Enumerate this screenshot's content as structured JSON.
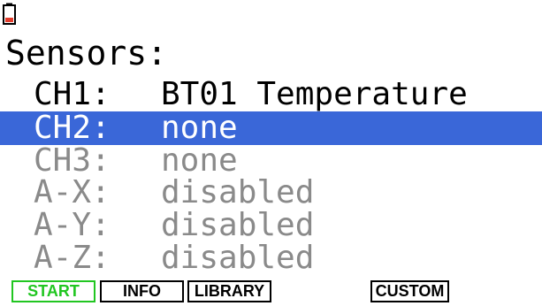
{
  "status": {
    "battery_icon": "battery-low-icon",
    "battery_color": "#e23a2a"
  },
  "screen": {
    "heading": "Sensors:"
  },
  "channels": [
    {
      "label": "CH1:",
      "value": "BT01 Temperature"
    },
    {
      "label": "CH2:",
      "value": "none"
    },
    {
      "label": "CH3:",
      "value": "none"
    },
    {
      "label": "A-X:",
      "value": "disabled"
    },
    {
      "label": "A-Y:",
      "value": "disabled"
    },
    {
      "label": "A-Z:",
      "value": "disabled"
    }
  ],
  "softkeys": {
    "start": "START",
    "info": "INFO",
    "library": "LIBRARY",
    "custom": "CUSTOM"
  },
  "colors": {
    "selection": "#3a67d8",
    "start_key": "#21c621",
    "disabled_text": "#8a8a8a"
  }
}
